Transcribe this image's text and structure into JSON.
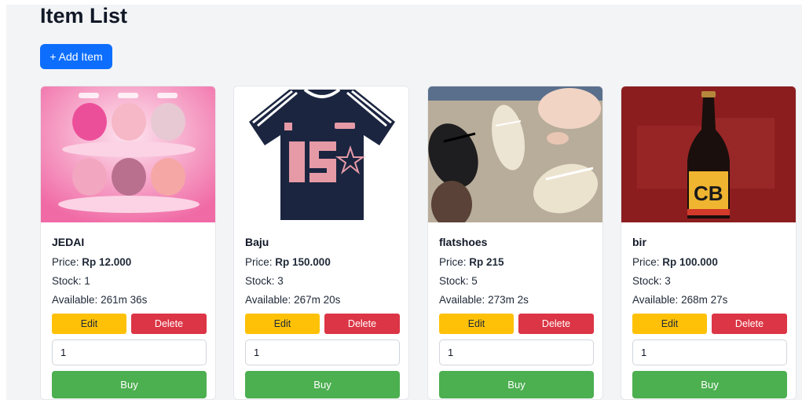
{
  "page": {
    "title": "Item List",
    "add_button_label": "+ Add Item"
  },
  "labels": {
    "price": "Price:",
    "stock": "Stock:",
    "available": "Available:",
    "edit": "Edit",
    "delete": "Delete",
    "buy": "Buy"
  },
  "items": [
    {
      "name": "JEDAI",
      "price": "Rp 12.000",
      "stock": "1",
      "available": "261m 36s",
      "quantity": "1",
      "image": "pink-hair-claw-clips-image"
    },
    {
      "name": "Baju",
      "price": "Rp 150.000",
      "stock": "3",
      "available": "267m 20s",
      "quantity": "1",
      "image": "navy-jersey-shirt-image"
    },
    {
      "name": "flatshoes",
      "price": "Rp 215",
      "stock": "5",
      "available": "273m 2s",
      "quantity": "1",
      "image": "flat-shoes-image"
    },
    {
      "name": "bir",
      "price": "Rp 100.000",
      "stock": "3",
      "available": "268m 27s",
      "quantity": "1",
      "image": "beer-bottle-image"
    }
  ],
  "colors": {
    "primary": "#0d6efd",
    "edit": "#ffc107",
    "delete": "#dc3545",
    "buy": "#4caf50",
    "background": "#f3f4f6"
  }
}
